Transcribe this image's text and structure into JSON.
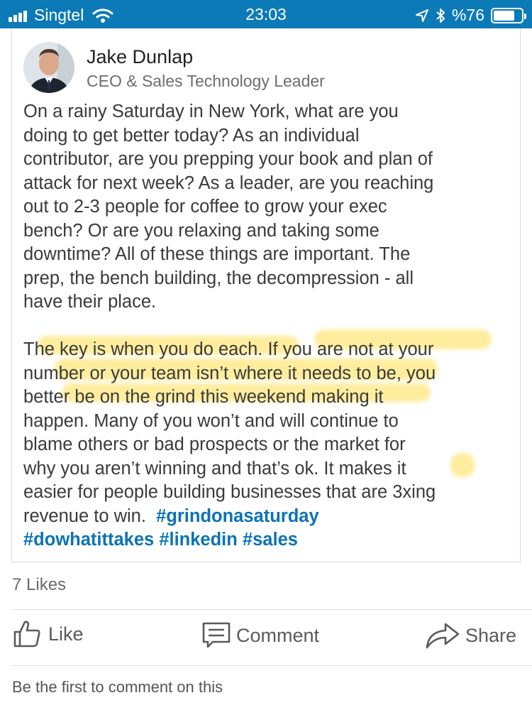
{
  "status_bar": {
    "carrier": "Singtel",
    "time": "23:03",
    "battery": "%76",
    "battery_level": 0.76
  },
  "post": {
    "author": {
      "name": "Jake Dunlap",
      "headline": "CEO & Sales Technology Leader"
    },
    "body_lines": [
      "On a rainy Saturday in New York, what are you",
      "doing to get better today?  As an individual",
      "contributor, are you prepping your book and plan of",
      "attack for next week? As a leader, are you reaching",
      "out to 2-3 people for coffee to grow your exec",
      "bench? Or are you relaxing and taking some",
      "downtime?  All of these things are important. The",
      "prep, the bench building, the decompression - all",
      "have their place.",
      "",
      "The key is when you do each.  If you are not at your",
      "number or your team isn’t where it needs to be, you",
      "better be on the grind this weekend making it",
      "happen. Many of you won’t and will continue to",
      "blame others or bad prospects or the market for",
      "why you aren’t winning and that’s ok. It makes it",
      "easier for people building businesses that are 3xing"
    ],
    "last_line_text": "revenue to win.  ",
    "hashtags": [
      "#grindonasaturday",
      "#dowhatittakes",
      "#linkedin",
      "#sales"
    ]
  },
  "likes": "7 Likes",
  "actions": {
    "like": "Like",
    "comment": "Comment",
    "share": "Share"
  },
  "comment_prompt": "Be the first to comment on this"
}
